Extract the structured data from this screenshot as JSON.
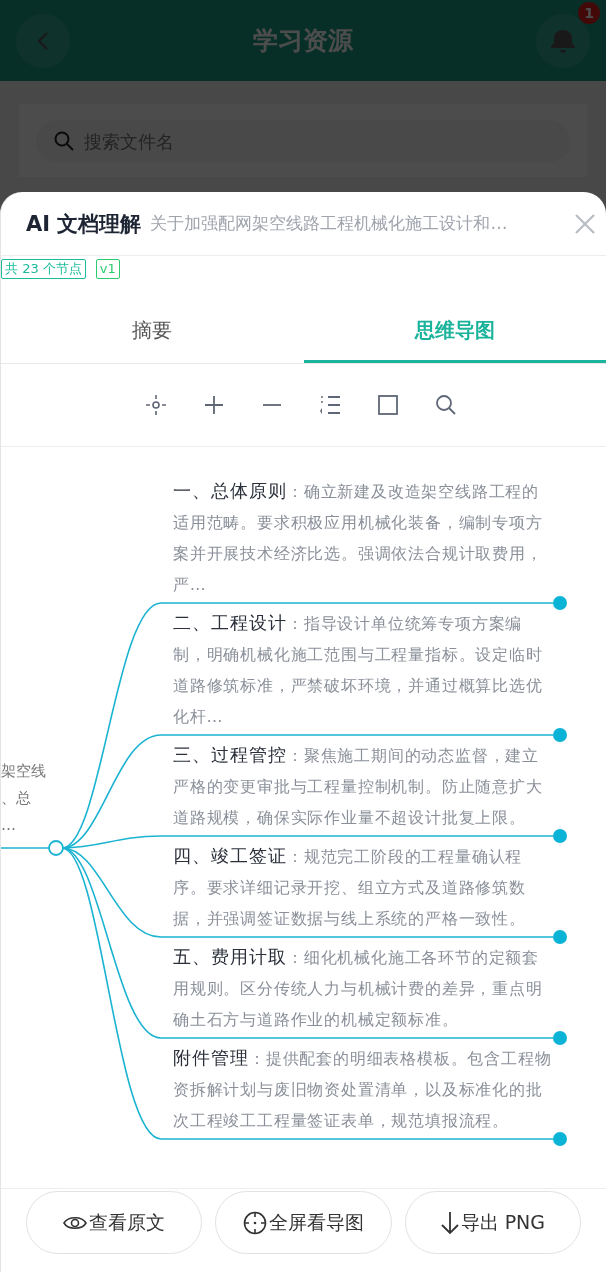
{
  "app_bar": {
    "title": "学习资源",
    "notification_count": "1"
  },
  "search": {
    "placeholder": "搜索文件名"
  },
  "panel": {
    "title": "AI 文档理解",
    "subtitle": "关于加强配网架空线路工程机械化施工设计和…",
    "tags": [
      {
        "label": "共 23 个节点",
        "color": "#1abc9c"
      },
      {
        "label": "v1",
        "color": "#2ecc71"
      }
    ]
  },
  "tabs": [
    {
      "label": "摘要",
      "selected": false
    },
    {
      "label": "思维导图",
      "selected": true
    }
  ],
  "mind_map": {
    "root": {
      "lines": [
        "架空线",
        "、总",
        "…"
      ]
    },
    "branches": [
      {
        "title": "一、总体原则",
        "text": "：确立新建及改造架空线路工程的适用范畴。要求积极应用机械化装备，编制专项方案并开展技术经济比选。强调依法合规计取费用，严…"
      },
      {
        "title": "二、工程设计",
        "text": "：指导设计单位统筹专项方案编制，明确机械化施工范围与工程量指标。设定临时道路修筑标准，严禁破坏环境，并通过概算比选优化杆…"
      },
      {
        "title": "三、过程管控",
        "text": "：聚焦施工期间的动态监督，建立严格的变更审批与工程量控制机制。防止随意扩大道路规模，确保实际作业量不超设计批复上限。"
      },
      {
        "title": "四、竣工签证",
        "text": "：规范完工阶段的工程量确认程序。要求详细记录开挖、组立方式及道路修筑数据，并强调签证数据与线上系统的严格一致性。"
      },
      {
        "title": "五、费用计取",
        "text": "：细化机械化施工各环节的定额套用规则。区分传统人力与机械计费的差异，重点明确土石方与道路作业的机械定额标准。"
      },
      {
        "title": "附件管理",
        "text": "：提供配套的明细表格模板。包含工程物资拆解计划与废旧物资处置清单，以及标准化的批次工程竣工工程量签证表单，规范填报流程。"
      }
    ]
  },
  "actions": [
    {
      "label": "查看原文"
    },
    {
      "label": "全屏看导图"
    },
    {
      "label": "导出 PNG"
    }
  ]
}
